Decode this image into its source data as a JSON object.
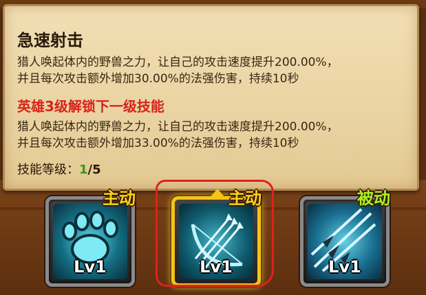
{
  "tooltip": {
    "title": "急速射击",
    "current_desc": [
      "猎人唤起体内的野兽之力，让自己的攻击速度提升200.00%，",
      "并且每次攻击额外增加30.00%的法强伤害，持续10秒"
    ],
    "unlock_heading": "英雄3级解锁下一级技能",
    "next_desc": [
      "猎人唤起体内的野兽之力，让自己的攻击速度提升200.00%，",
      "并且每次攻击额外增加33.00%的法强伤害，持续10秒"
    ],
    "level_label": "技能等级：",
    "level_current": "1",
    "level_sep": "/",
    "level_max": "5"
  },
  "skills": [
    {
      "badge": "主动",
      "level": "Lv1",
      "icon": "paw-claw-icon",
      "selected": false
    },
    {
      "badge": "主动",
      "level": "Lv1",
      "icon": "bow-arrows-icon",
      "selected": true
    },
    {
      "badge": "被动",
      "level": "Lv1",
      "icon": "arrow-volley-icon",
      "selected": false
    }
  ],
  "colors": {
    "unlock_text": "#d8221a",
    "level_current": "#2f9b1e",
    "active_badge": "#f8d21c",
    "passive_badge": "#a8f02c",
    "selected_border": "#f4c417",
    "annotation": "#e0201c"
  }
}
